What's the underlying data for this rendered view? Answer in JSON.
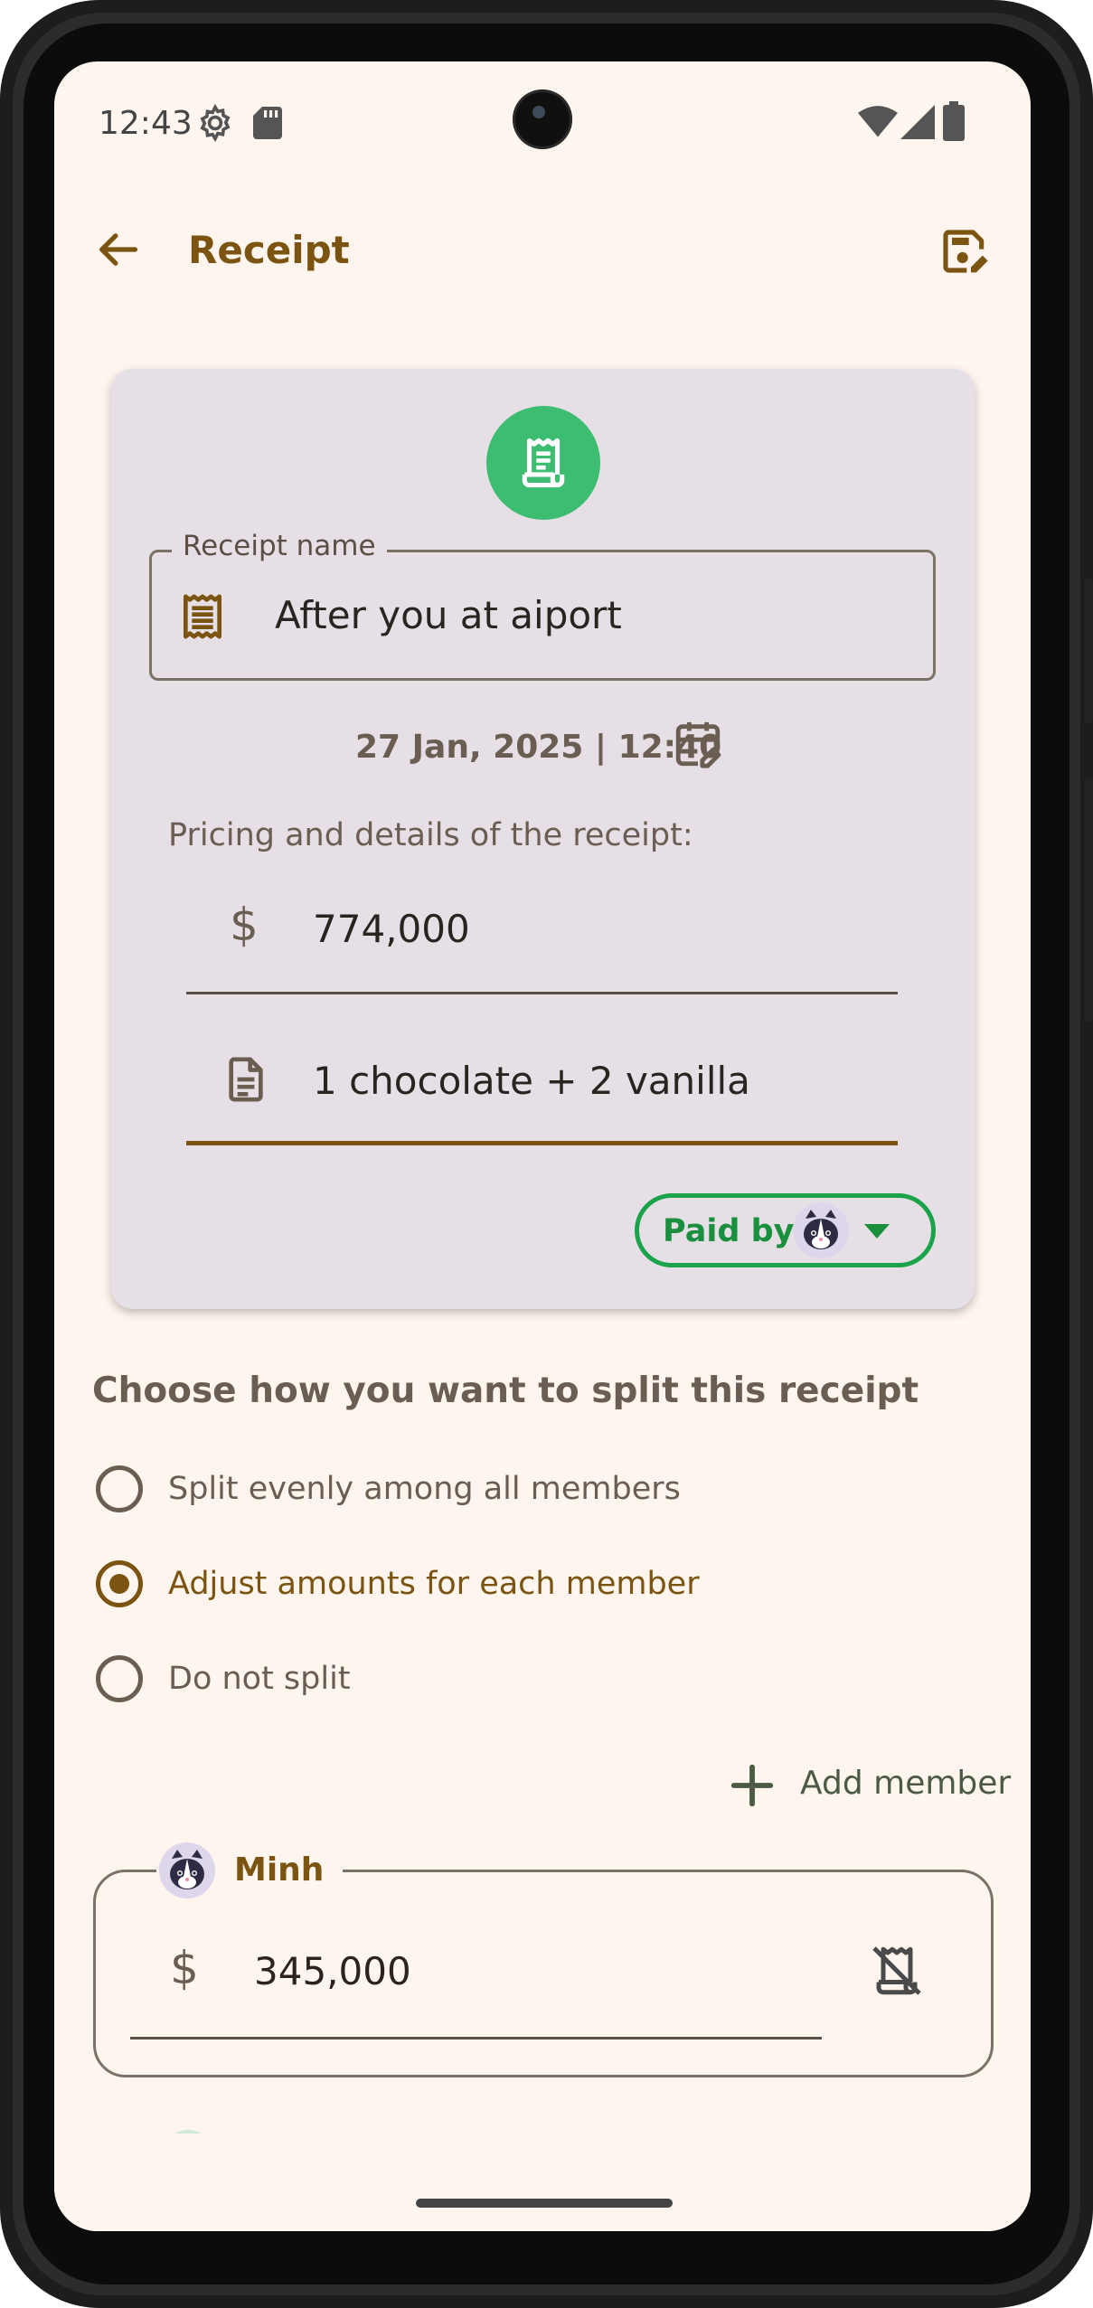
{
  "status_bar": {
    "time": "12:43",
    "left_icons": [
      "settings-gear-icon",
      "sd-card-icon"
    ],
    "right_icons": [
      "wifi-icon",
      "cell-signal-icon",
      "battery-icon"
    ]
  },
  "app_bar": {
    "back_icon": "arrow-back-icon",
    "title": "Receipt",
    "save_icon": "save-edit-icon"
  },
  "receipt_card": {
    "receipt_icon": "receipt-icon",
    "name_field": {
      "label": "Receipt name",
      "value": "After you at aiport",
      "icon": "receipt-long-icon"
    },
    "datetime": "27 Jan, 2025 | 12:40",
    "calendar_icon": "edit-calendar-icon",
    "pricing_label": "Pricing and details of the receipt:",
    "amount": {
      "currency_symbol": "$",
      "value": "774,000"
    },
    "description": {
      "icon": "description-icon",
      "value": "1 chocolate + 2 vanilla"
    },
    "paid_by": {
      "label": "Paid by",
      "avatar_icon": "skunk-avatar-icon",
      "dropdown_icon": "dropdown-arrow-icon"
    }
  },
  "split_section": {
    "heading": "Choose how you want to split this receipt",
    "options": [
      {
        "label": "Split evenly among all members",
        "selected": false
      },
      {
        "label": "Adjust amounts for each member",
        "selected": true
      },
      {
        "label": "Do not split",
        "selected": false
      }
    ],
    "add_member_label": "Add member",
    "add_icon": "plus-icon"
  },
  "members": [
    {
      "name": "Minh",
      "avatar_icon": "skunk-avatar-icon",
      "currency_symbol": "$",
      "amount": "345,000",
      "action_icon": "receipt-off-icon"
    }
  ],
  "colors": {
    "background": "#fef6ee",
    "card": "#e6e0e6",
    "primary": "#7a5410",
    "accent_green": "#1aa34a",
    "receipt_circle": "#3dbd72"
  }
}
